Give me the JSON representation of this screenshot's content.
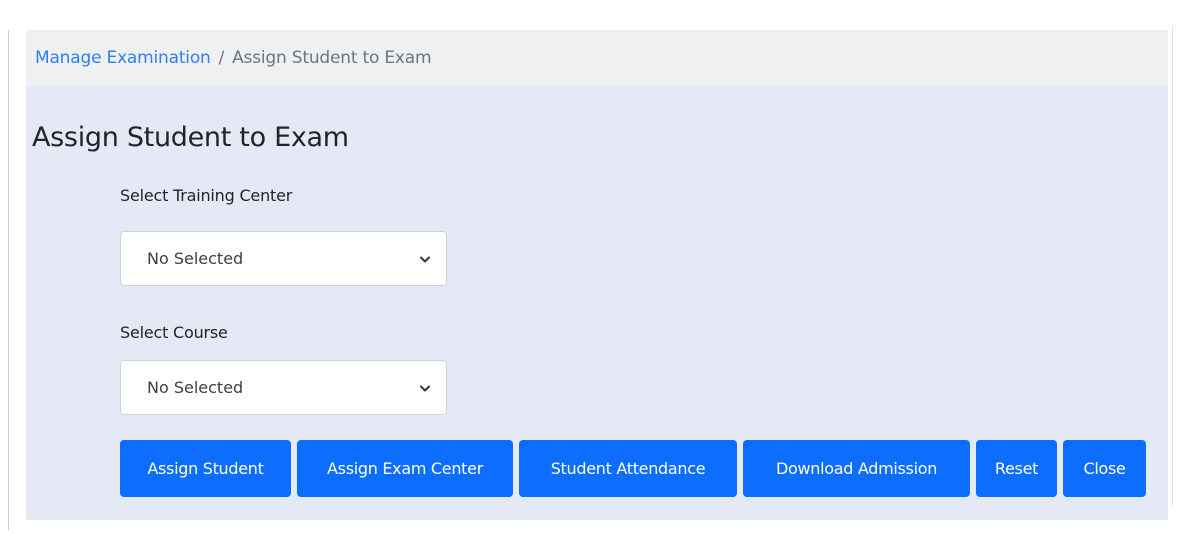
{
  "breadcrumb": {
    "parent": "Manage Examination",
    "separator": "/",
    "current": "Assign Student to Exam"
  },
  "page": {
    "title": "Assign Student to Exam"
  },
  "form": {
    "training_center": {
      "label": "Select Training Center",
      "selected": "No Selected"
    },
    "course": {
      "label": "Select Course",
      "selected": "No Selected"
    }
  },
  "actions": {
    "assign_student": "Assign Student",
    "assign_exam_center": "Assign Exam Center",
    "student_attendance": "Student Attendance",
    "download_admission": "Download Admission",
    "reset": "Reset",
    "close": "Close"
  },
  "colors": {
    "primary": "#0d6efd",
    "link": "#2f7ff0",
    "panel_bg": "#e5e9f6",
    "breadcrumb_bg": "#eef0f2"
  },
  "icons": {
    "select_arrow": "chevron-down-icon"
  }
}
